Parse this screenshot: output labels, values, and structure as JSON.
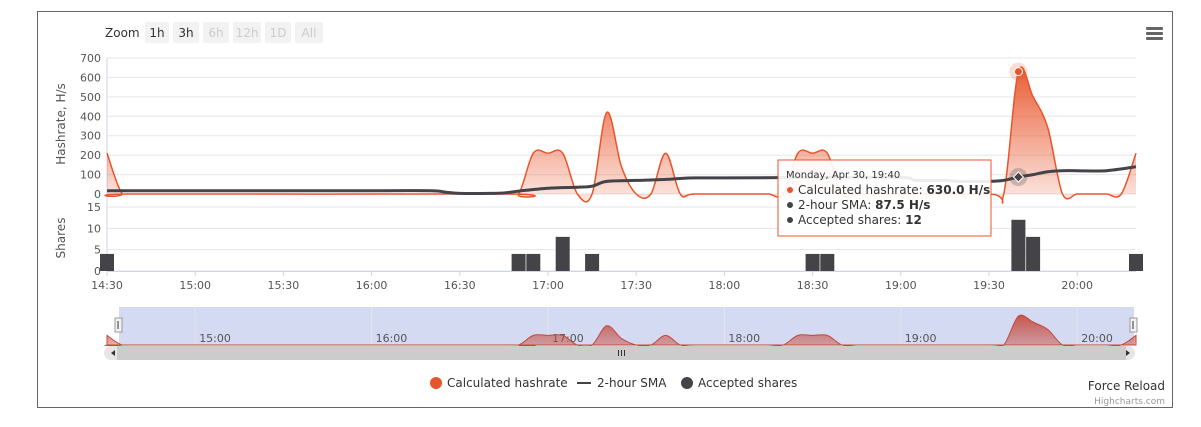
{
  "zoom": {
    "label": "Zoom",
    "buttons": [
      {
        "label": "1h",
        "enabled": true
      },
      {
        "label": "3h",
        "enabled": true
      },
      {
        "label": "6h",
        "enabled": false
      },
      {
        "label": "12h",
        "enabled": false
      },
      {
        "label": "1D",
        "enabled": false
      },
      {
        "label": "All",
        "enabled": false
      }
    ]
  },
  "force_reload_label": "Force Reload",
  "credits": "Highcharts.com",
  "navigator_labels": [
    "15:00",
    "16:00",
    "17:00",
    "18:00",
    "19:00",
    "20:00"
  ],
  "tooltip": {
    "header": "Monday, Apr 30, 19:40",
    "rows": [
      {
        "name": "Calculated hashrate",
        "value": "630.0 H/s",
        "color": "#e8552b"
      },
      {
        "name": "2-hour SMA",
        "value": "87.5 H/s",
        "color": "#434348"
      },
      {
        "name": "Accepted shares",
        "value": "12",
        "color": "#434348"
      }
    ]
  },
  "chart_data": [
    {
      "type": "area",
      "ylabel": "Hashrate, H/s",
      "ylim": [
        0,
        700
      ],
      "yticks": [
        0,
        100,
        200,
        300,
        400,
        500,
        600,
        700
      ],
      "x_ticks": [
        "14:30",
        "15:00",
        "15:30",
        "16:00",
        "16:30",
        "17:00",
        "17:30",
        "18:00",
        "18:30",
        "19:00",
        "19:30",
        "20:00"
      ],
      "grid": true,
      "series": [
        {
          "name": "Calculated hashrate",
          "type": "area",
          "color": "#e8552b",
          "x": [
            "14:30",
            "14:35",
            "14:40",
            "16:45",
            "16:50",
            "16:55",
            "17:00",
            "17:05",
            "17:10",
            "17:15",
            "17:20",
            "17:25",
            "17:30",
            "17:35",
            "17:40",
            "17:45",
            "17:50",
            "18:10",
            "18:15",
            "18:20",
            "18:25",
            "18:30",
            "18:35",
            "18:40",
            "18:45",
            "18:50",
            "19:30",
            "19:35",
            "19:40",
            "19:45",
            "19:50",
            "19:55",
            "20:00",
            "20:05",
            "20:10",
            "20:15",
            "20:20"
          ],
          "values": [
            210,
            5,
            0,
            0,
            0,
            210,
            210,
            210,
            0,
            0,
            420,
            140,
            0,
            0,
            210,
            0,
            0,
            0,
            0,
            0,
            210,
            210,
            210,
            0,
            0,
            0,
            0,
            0,
            630,
            500,
            340,
            0,
            0,
            0,
            0,
            0,
            210
          ]
        },
        {
          "name": "2-hour SMA",
          "type": "line",
          "color": "#434348",
          "x": [
            "14:30",
            "14:40",
            "15:00",
            "16:00",
            "16:20",
            "16:25",
            "16:30",
            "16:40",
            "16:45",
            "16:50",
            "17:00",
            "17:10",
            "17:15",
            "17:20",
            "17:30",
            "17:40",
            "17:45",
            "17:50",
            "18:00",
            "18:30",
            "19:00",
            "19:05",
            "19:15",
            "19:20",
            "19:30",
            "19:35",
            "19:40",
            "19:45",
            "19:50",
            "19:55",
            "20:00",
            "20:10",
            "20:20"
          ],
          "values": [
            17,
            17,
            17,
            17,
            17,
            10,
            3,
            3,
            5,
            15,
            30,
            35,
            40,
            65,
            70,
            75,
            80,
            83,
            83,
            85,
            85,
            70,
            70,
            65,
            65,
            70,
            87.5,
            100,
            115,
            120,
            120,
            120,
            140
          ]
        }
      ]
    },
    {
      "type": "bar",
      "ylabel": "Shares",
      "ylim": [
        0,
        15
      ],
      "yticks": [
        0,
        5,
        10,
        15
      ],
      "series": [
        {
          "name": "Accepted shares",
          "color": "#434348",
          "x": [
            "14:30",
            "16:50",
            "16:55",
            "17:05",
            "17:15",
            "18:30",
            "18:35",
            "19:40",
            "19:45",
            "20:20"
          ],
          "values": [
            4,
            4,
            4,
            8,
            4,
            4,
            4,
            12,
            8,
            4
          ]
        }
      ]
    }
  ]
}
